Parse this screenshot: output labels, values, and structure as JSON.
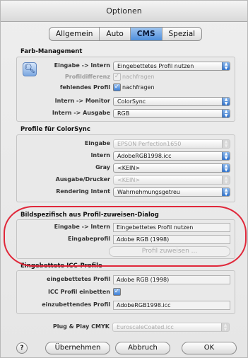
{
  "window": {
    "title": "Optionen"
  },
  "tabs": [
    {
      "label": "Allgemein",
      "active": false
    },
    {
      "label": "Auto",
      "active": false
    },
    {
      "label": "CMS",
      "active": true
    },
    {
      "label": "Spezial",
      "active": false
    }
  ],
  "farb_management": {
    "title": "Farb-Management",
    "icon": "magnifier-icon",
    "eingabe_intern": {
      "label": "Eingabe -> Intern",
      "value": "Eingebettetes Profil nutzen"
    },
    "profildifferenz": {
      "label": "Profildifferenz",
      "value": "nachfragen",
      "checked": true,
      "enabled": false
    },
    "fehlendes_profil": {
      "label": "fehlendes Profil",
      "value": "nachfragen",
      "checked": true
    },
    "intern_monitor": {
      "label": "Intern -> Monitor",
      "value": "ColorSync"
    },
    "intern_ausgabe": {
      "label": "Intern -> Ausgabe",
      "value": "RGB"
    }
  },
  "profile_colorsync": {
    "title": "Profile für ColorSync",
    "eingabe": {
      "label": "Eingabe",
      "value": "EPSON Perfection1650",
      "enabled": false
    },
    "intern": {
      "label": "Intern",
      "value": "AdobeRGB1998.icc"
    },
    "gray": {
      "label": "Gray",
      "value": "<KEIN>"
    },
    "ausgabe_drucker": {
      "label": "Ausgabe/Drucker",
      "value": "<KEIN>",
      "enabled": false
    },
    "rendering_intent": {
      "label": "Rendering Intent",
      "value": "Wahrnehmungsgetreu"
    }
  },
  "bildspezifisch": {
    "title": "Bildspezifisch aus Profil-zuweisen-Dialog",
    "eingabe_intern": {
      "label": "Eingabe -> Intern",
      "value": "Eingebettetes Profil nutzen"
    },
    "eingabeprofil": {
      "label": "Eingabeprofil",
      "value": "Adobe RGB (1998)"
    },
    "assign_button": "Profil zuweisen ..."
  },
  "icc_profile": {
    "title": "Eingebettete ICC-Profile",
    "eingebettetes_profil": {
      "label": "eingebettetes Profil",
      "value": "Adobe RGB (1998)"
    },
    "icc_einbetten": {
      "label": "ICC Profil einbetten",
      "checked": true
    },
    "einzubettendes_profil": {
      "label": "einzubettendes Profil",
      "value": "AdobeRGB1998.icc"
    }
  },
  "plug_play": {
    "label": "Plug & Play CMYK",
    "value": "EuroscaleCoated.icc",
    "enabled": false
  },
  "footer": {
    "help": "?",
    "apply": "Übernehmen",
    "cancel": "Abbruch",
    "ok": "OK"
  },
  "colors": {
    "accent": "#4f8fdc",
    "annotation_ring": "#e0283a"
  }
}
